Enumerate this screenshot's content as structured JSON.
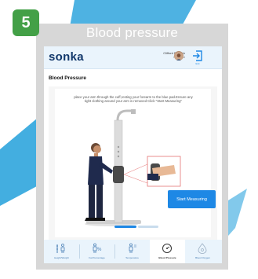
{
  "step": {
    "number": "5"
  },
  "frame": {
    "title": "Blood pressure"
  },
  "header": {
    "logo": "sonka",
    "user_name": "Clifford Baldwin",
    "user_meta": "Male • 34",
    "exit_label": "Exit"
  },
  "page": {
    "title": "Blood Pressure"
  },
  "instructions": "place your arm through the cuff,resting your forearm to the blue pad.Ensure any tight clothing around your arm is removed Click \"Start Measuring\"",
  "actions": {
    "start": "Start Measuring"
  },
  "progress": {
    "steps_completed": 1,
    "steps_total": 2
  },
  "nav": {
    "items": [
      {
        "label": "Height/Weight",
        "icon": "height-weight-icon"
      },
      {
        "label": "Fat Percentage",
        "icon": "fat-percentage-icon"
      },
      {
        "label": "Temperature",
        "icon": "temperature-icon"
      },
      {
        "label": "Blood Pressure",
        "icon": "blood-pressure-icon"
      },
      {
        "label": "Blood Oxygen",
        "icon": "blood-oxygen-icon"
      }
    ],
    "active_index": 3
  },
  "colors": {
    "badge": "#43a047",
    "frame": "#d7d7d7",
    "accent": "#1e88e5",
    "logo": "#12386b",
    "background_shape": "#2fa5dd"
  }
}
